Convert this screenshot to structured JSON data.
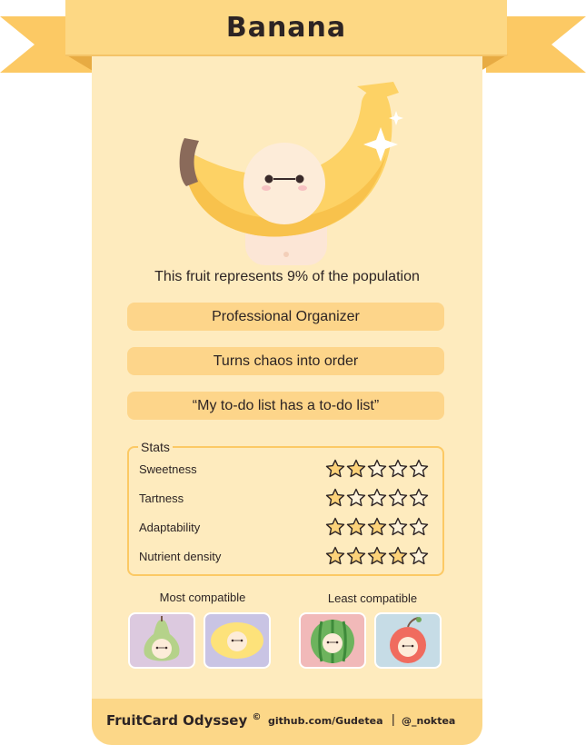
{
  "card": {
    "title": "Banana",
    "population_text": "This fruit represents 9% of the population",
    "role": "Professional Organizer",
    "tagline": "Turns chaos into order",
    "quote": "“My to-do list has a to-do list”"
  },
  "stats": {
    "title": "Stats",
    "items": [
      {
        "label": "Sweetness",
        "rating": 2,
        "max": 5
      },
      {
        "label": "Tartness",
        "rating": 1,
        "max": 5
      },
      {
        "label": "Adaptability",
        "rating": 3,
        "max": 5
      },
      {
        "label": "Nutrient density",
        "rating": 4,
        "max": 5
      }
    ]
  },
  "compatibility": {
    "most_label": "Most compatible",
    "least_label": "Least compatible",
    "most": [
      {
        "icon": "pear-icon",
        "bg": "#dcc9df"
      },
      {
        "icon": "lemon-icon",
        "bg": "#c9c4e4"
      }
    ],
    "least": [
      {
        "icon": "watermelon-icon",
        "bg": "#f1b9b9"
      },
      {
        "icon": "cherry-icon",
        "bg": "#c6dce6"
      }
    ]
  },
  "footer": {
    "brand": "FruitCard Odyssey",
    "copyright": "©",
    "github": "github.com/Gudetea",
    "separator": "|",
    "handle": "@_noktea"
  },
  "colors": {
    "banner": "#fdd884",
    "card_bg": "#feebbe",
    "pill": "#fdd58a",
    "accent": "#fcc964",
    "star_fill": "#fcd279",
    "text": "#2d2424"
  }
}
